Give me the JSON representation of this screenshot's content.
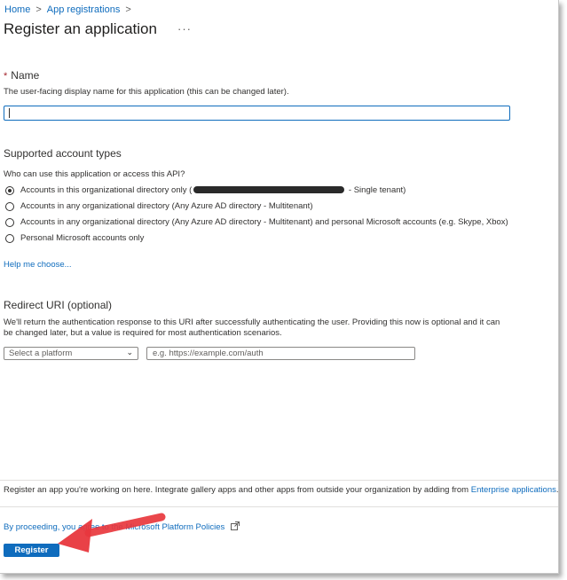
{
  "breadcrumb": {
    "items": [
      "Home",
      "App registrations"
    ],
    "separator": ">"
  },
  "page": {
    "title": "Register an application",
    "more": "···"
  },
  "name_section": {
    "required_mark": "*",
    "label": "Name",
    "help": "The user-facing display name for this application (this can be changed later).",
    "value": ""
  },
  "account_types": {
    "heading": "Supported account types",
    "question": "Who can use this application or access this API?",
    "options": [
      {
        "prefix": "Accounts in this organizational directory only (",
        "suffix": " - Single tenant)",
        "selected": true
      },
      {
        "label": "Accounts in any organizational directory (Any Azure AD directory - Multitenant)",
        "selected": false
      },
      {
        "label": "Accounts in any organizational directory (Any Azure AD directory - Multitenant) and personal Microsoft accounts (e.g. Skype, Xbox)",
        "selected": false
      },
      {
        "label": "Personal Microsoft accounts only",
        "selected": false
      }
    ],
    "help_link": "Help me choose..."
  },
  "redirect": {
    "heading": "Redirect URI (optional)",
    "description": "We'll return the authentication response to this URI after successfully authenticating the user. Providing this now is optional and it can be changed later, but a value is required for most authentication scenarios.",
    "platform_placeholder": "Select a platform",
    "uri_placeholder": "e.g. https://example.com/auth"
  },
  "footer": {
    "note_text": "Register an app you're working on here. Integrate gallery apps and other apps from outside your organization by adding from",
    "note_link": "Enterprise applications",
    "policy_text": "By proceeding, you agree to the Microsoft Platform Policies",
    "register_label": "Register"
  },
  "colors": {
    "accent": "#0f6cbd",
    "annotation_arrow": "#e8373d"
  }
}
